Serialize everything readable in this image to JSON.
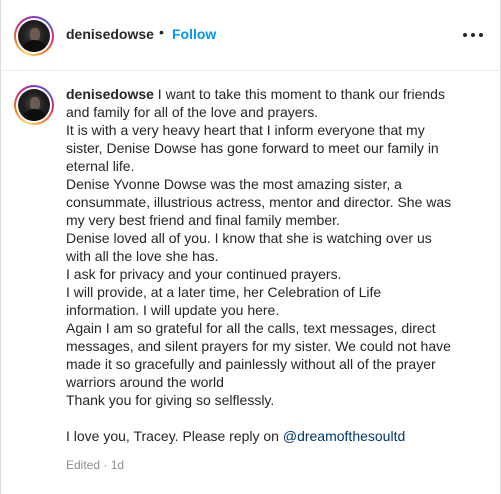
{
  "header": {
    "username": "denisedowse",
    "separator": "•",
    "follow_label": "Follow",
    "more_icon": "more-horizontal-icon"
  },
  "caption": {
    "username": "denisedowse",
    "first_line_text": " I want to take this moment to thank our friends",
    "lines": [
      "and family for all of the love and prayers.",
      "It is with a very heavy heart that I inform everyone that my",
      "sister, Denise Dowse has gone forward to meet our family in",
      "eternal life.",
      "Denise Yvonne Dowse was the most amazing sister, a",
      "consummate, illustrious actress, mentor and director. She was",
      "my very best friend and final family member.",
      "Denise loved all of you. I know that she is watching over us",
      "with all the love she has.",
      "I ask for privacy and your continued prayers.",
      "I will provide, at a later time, her Celebration of Life",
      "information. I will update you here.",
      "Again I am so grateful for all the calls, text messages, direct",
      "messages, and silent prayers for my sister. We could not have",
      "made it so gracefully and painlessly without all of the prayer",
      "warriors around the world",
      "Thank you for giving so selflessly."
    ],
    "closing_text": "I love you, Tracey. Please reply on ",
    "mention": "@dreamofthesoultd"
  },
  "meta": {
    "edited": "Edited · 1d"
  },
  "colors": {
    "link_blue": "#0095f6",
    "mention": "#00376b",
    "text": "#262626",
    "muted": "#8e8e8e"
  }
}
